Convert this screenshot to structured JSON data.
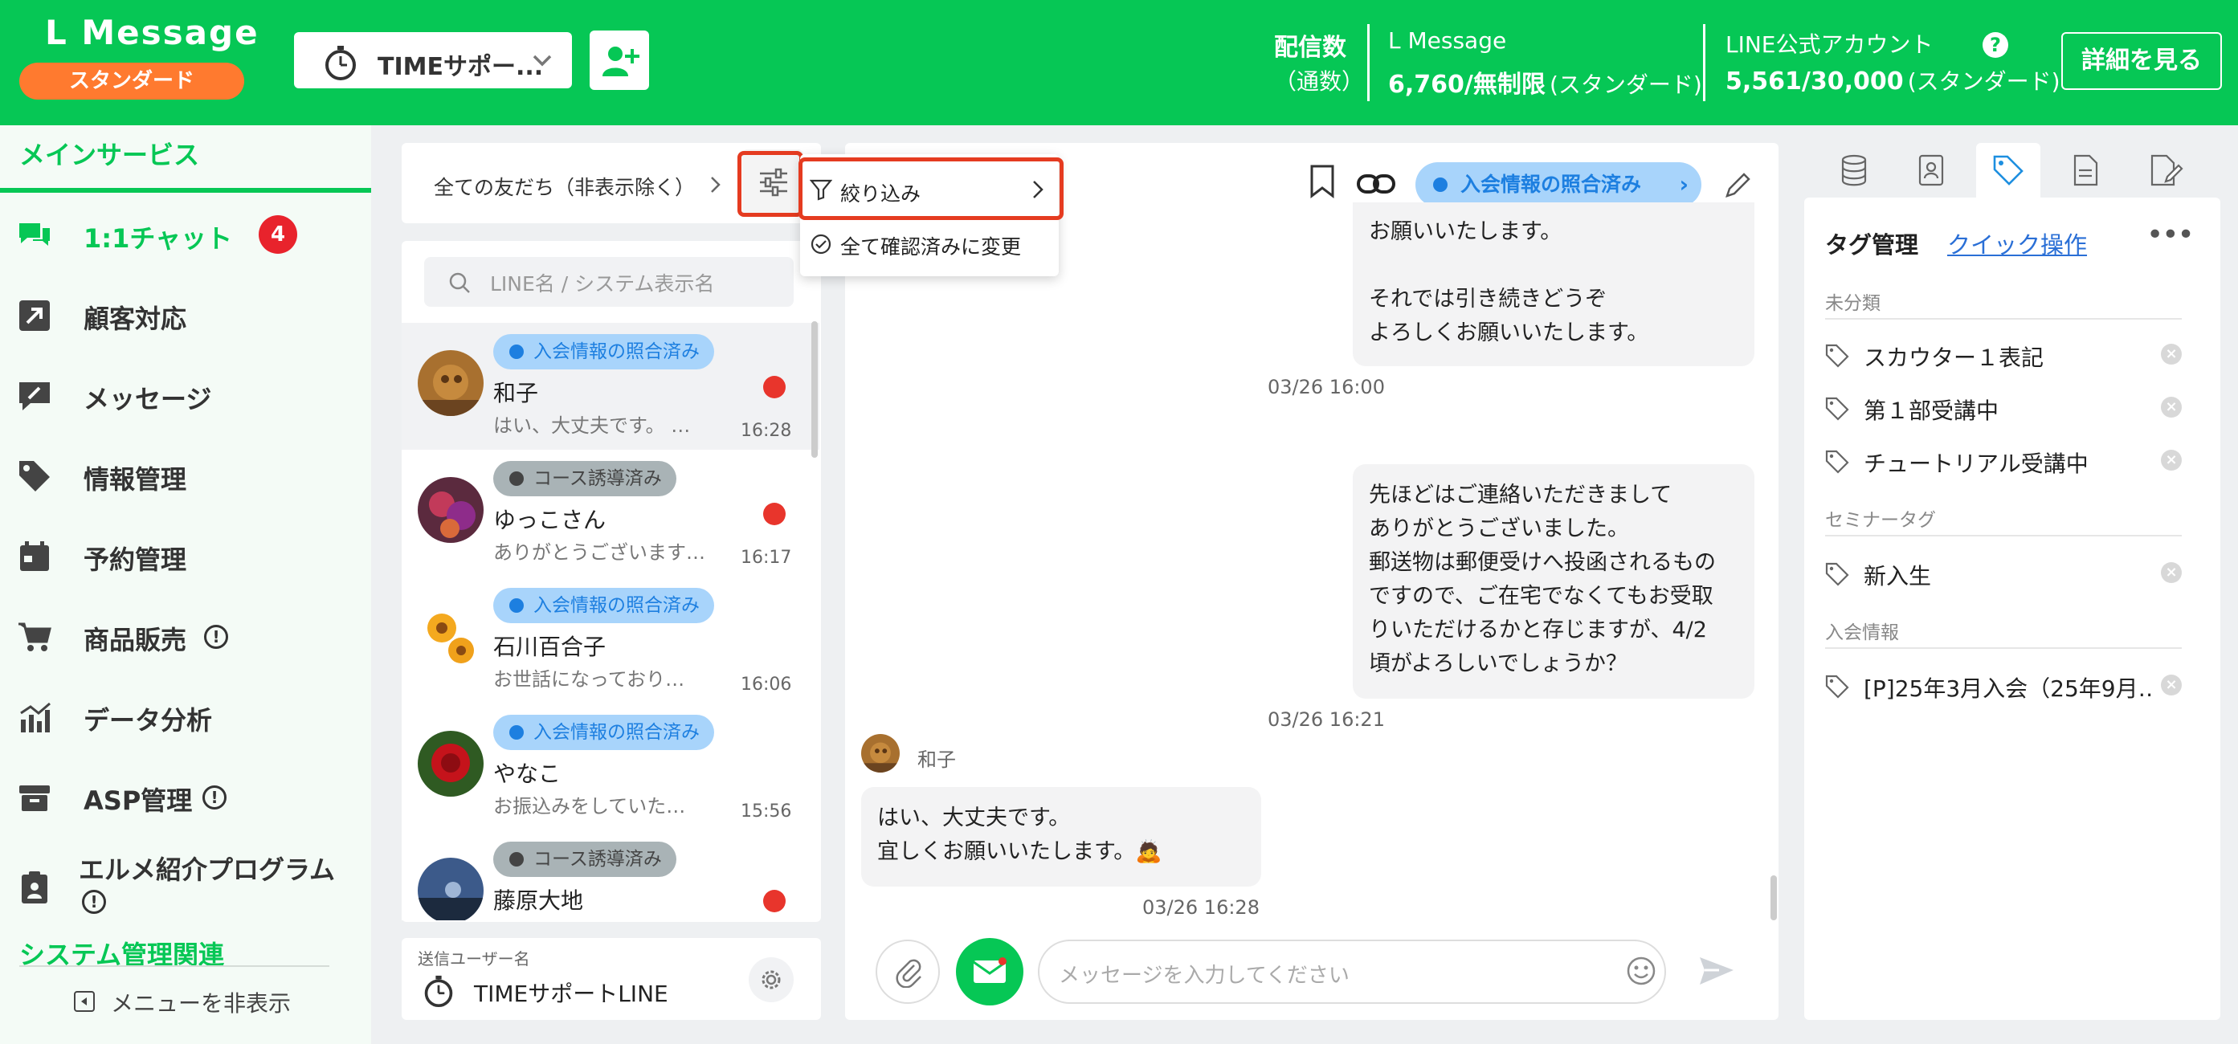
{
  "header": {
    "brand": "L Message",
    "plan_badge": "スタンダード",
    "account_name": "TIMEサポー...",
    "stats_title": "配信数",
    "stats_title_sub": "（通数）",
    "lmessage_label": "L Message",
    "lmessage_value": "6,760/無制限",
    "lmessage_plan": "(スタンダード)",
    "line_label": "LINE公式アカウント",
    "line_value": "5,561/30,000",
    "line_plan": "(スタンダード)",
    "detail_button": "詳細を見る",
    "help_glyph": "?"
  },
  "sidebar": {
    "section_main": "メインサービス",
    "items": [
      {
        "label": "1:1チャット",
        "icon": "chat-icon"
      },
      {
        "label": "顧客対応",
        "icon": "arrow-up-right-icon"
      },
      {
        "label": "メッセージ",
        "icon": "message-edit-icon"
      },
      {
        "label": "情報管理",
        "icon": "tag-icon"
      },
      {
        "label": "予約管理",
        "icon": "calendar-icon"
      },
      {
        "label": "商品販売",
        "icon": "cart-icon"
      },
      {
        "label": "データ分析",
        "icon": "bar-chart-icon"
      },
      {
        "label": "ASP管理",
        "icon": "box-icon"
      },
      {
        "label": "エルメ紹介プログラム",
        "icon": "clipboard-person-icon"
      }
    ],
    "chat_badge": "4",
    "warn_glyph": "!",
    "section_system": "システム管理関連",
    "hide_menu": "メニューを非表示"
  },
  "friend_list": {
    "filter_label": "全ての友だち（非表示除く）",
    "search_placeholder": "LINE名 / システム表示名",
    "friends": [
      {
        "tag": "入会情報の照合済み",
        "name": "和子",
        "preview": "はい、大丈夫です。 …",
        "time": "16:28",
        "unread": true
      },
      {
        "tag": "コース誘導済み",
        "name": "ゆっこさん",
        "preview": "ありがとうございます…",
        "time": "16:17",
        "unread": true
      },
      {
        "tag": "入会情報の照合済み",
        "name": "石川百合子",
        "preview": "お世話になっており…",
        "time": "16:06",
        "unread": false
      },
      {
        "tag": "入会情報の照合済み",
        "name": "やなこ",
        "preview": "お振込みをしていた…",
        "time": "15:56",
        "unread": false
      },
      {
        "tag": "コース誘導済み",
        "name": "藤原大地",
        "preview": "",
        "time": "",
        "unread": true
      }
    ],
    "sender_label": "送信ユーザー名",
    "sender_name": "TIMEサポートLINE"
  },
  "dropdown": {
    "filter": "絞り込み",
    "mark_all_read": "全て確認済みに変更"
  },
  "chat": {
    "status_tag": "入会情報の照合済み",
    "messages": [
      {
        "lines": [
          "お願いいたします。",
          "",
          "それでは引き続きどうぞ",
          "よろしくお願いいたします。"
        ],
        "time": "03/26 16:00"
      },
      {
        "lines": [
          "先ほどはご連絡いただきまして",
          "ありがとうございました。",
          "郵送物は郵便受けへ投函されるもの",
          "ですので、ご在宅でなくてもお受取",
          "りいただけるかと存じますが、4/2",
          "頃がよろしいでしょうか？"
        ],
        "time": "03/26 16:21"
      },
      {
        "sender": "和子",
        "lines": [
          "はい、大丈夫です。",
          "宜しくお願いいたします。🙇"
        ],
        "time": "03/26 16:28"
      }
    ],
    "input_placeholder": "メッセージを入力してください"
  },
  "right_panel": {
    "title": "タグ管理",
    "quick_op": "クイック操作",
    "more": "•••",
    "sections": [
      {
        "title": "未分類",
        "tags": [
          "スカウター１表記",
          "第１部受講中",
          "チュートリアル受講中"
        ]
      },
      {
        "title": "セミナータグ",
        "tags": [
          "新入生"
        ]
      },
      {
        "title": "入会情報",
        "tags": [
          "[P]25年3月入会（25年9月…"
        ]
      }
    ],
    "remove_glyph": "×"
  },
  "colors": {
    "brand_green": "#06c755",
    "badge_orange": "#ff7a2f",
    "highlight_red": "#e53b20",
    "tag_blue": "#a8d4fb",
    "tag_gray": "#a9b3b6"
  }
}
